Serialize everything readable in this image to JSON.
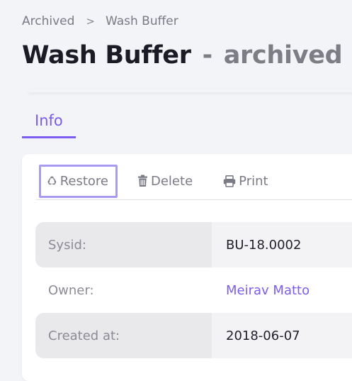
{
  "breadcrumb": {
    "items": [
      "Archived",
      "Wash Buffer"
    ],
    "separator": ">"
  },
  "title": {
    "name": "Wash Buffer",
    "dash": "-",
    "status": "archived"
  },
  "tabs": [
    {
      "label": "Info",
      "active": true
    }
  ],
  "toolbar": {
    "restore": {
      "label": "Restore",
      "icon": "recycle-icon"
    },
    "delete": {
      "label": "Delete",
      "icon": "trash-icon"
    },
    "print": {
      "label": "Print",
      "icon": "printer-icon"
    }
  },
  "fields": [
    {
      "label": "Sysid:",
      "value": "BU-18.0002"
    },
    {
      "label": "Owner:",
      "value": "Meirav Matto"
    },
    {
      "label": "Created at:",
      "value": "2018-06-07"
    }
  ],
  "colors": {
    "accent": "#7a5cf0",
    "background": "#f3f4f7",
    "muted_text": "#7b7b86"
  }
}
